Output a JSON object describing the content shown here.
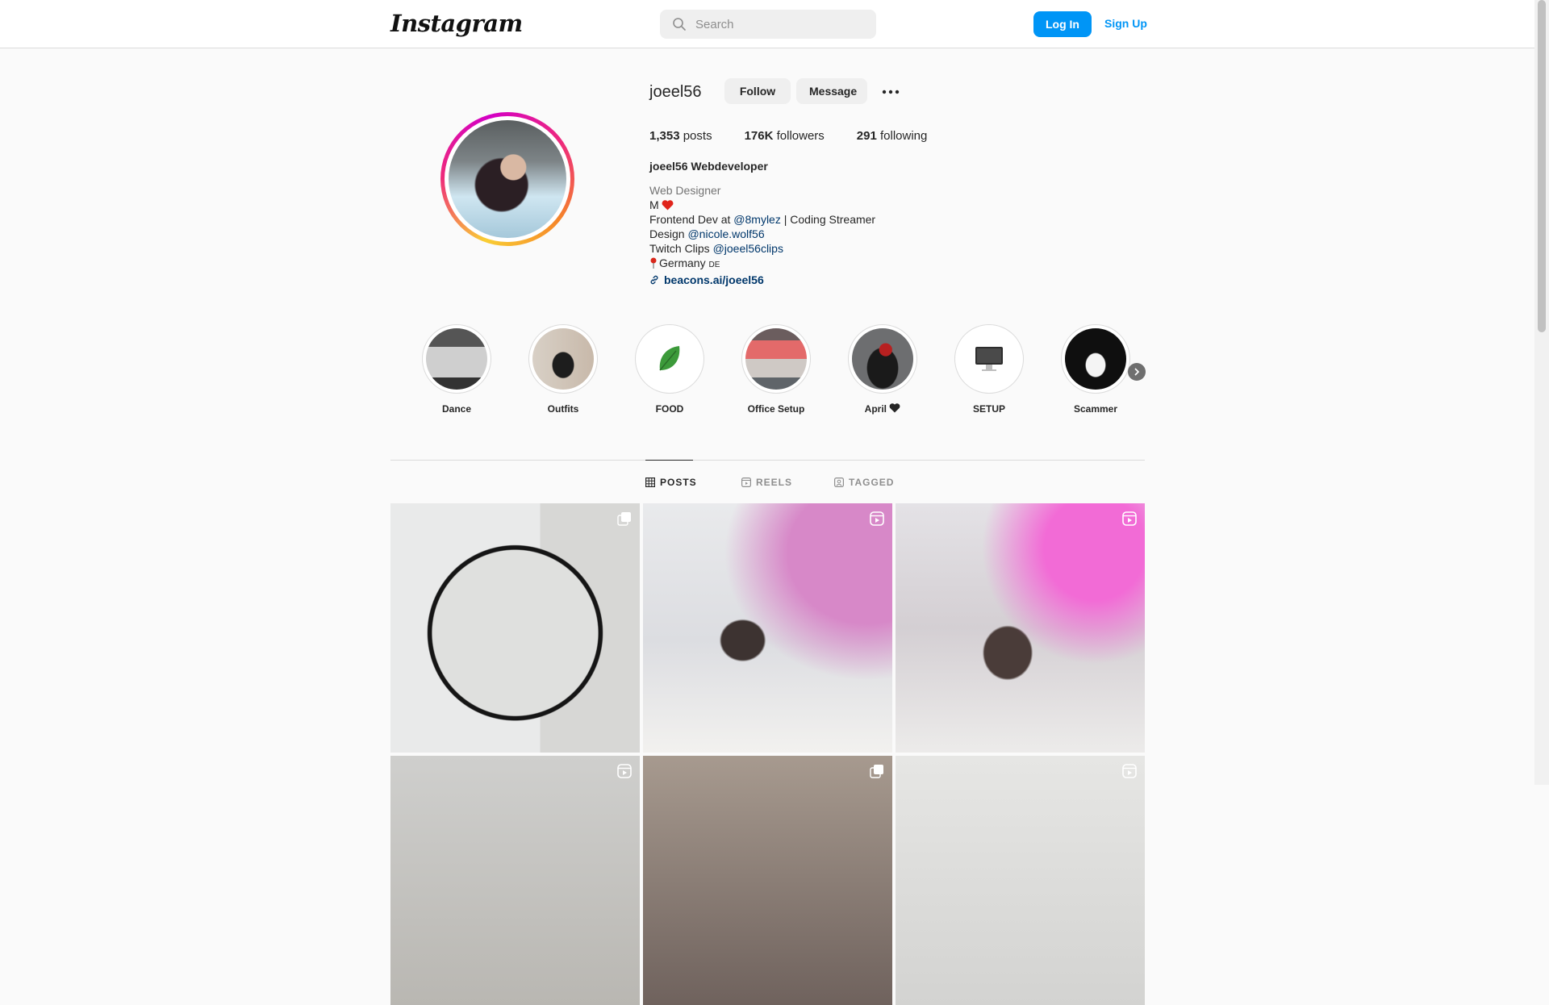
{
  "header": {
    "logo_text": "Instagram",
    "search_placeholder": "Search",
    "login_label": "Log In",
    "signup_label": "Sign Up"
  },
  "profile": {
    "username": "joeel56",
    "follow_label": "Follow",
    "message_label": "Message",
    "stats": {
      "posts_count": "1,353",
      "posts_label": "posts",
      "followers_count": "176K",
      "followers_label": "followers",
      "following_count": "291",
      "following_label": "following"
    },
    "full_name": "joeel56 Webdeveloper",
    "category": "Web Designer",
    "bio": {
      "line1": "M",
      "line2_prefix": "Frontend Dev at ",
      "line2_mention": "@8mylez",
      "line2_suffix": " | Coding Streamer",
      "line3_prefix": "Design ",
      "line3_mention": "@nicole.wolf56",
      "line4_prefix": "Twitch Clips ",
      "line4_mention": "@joeel56clips",
      "line5_text": "Germany ",
      "line5_flag": "DE",
      "link": "beacons.ai/joeel56"
    }
  },
  "highlights": [
    {
      "label": "Dance"
    },
    {
      "label": "Outfits"
    },
    {
      "label": "FOOD"
    },
    {
      "label": "Office Setup"
    },
    {
      "label": "April"
    },
    {
      "label": "SETUP"
    },
    {
      "label": "Scammer"
    }
  ],
  "tabs": {
    "posts": "POSTS",
    "reels": "REELS",
    "tagged": "TAGGED"
  },
  "posts_badges": [
    "carousel-icon",
    "reel-icon",
    "reel-icon",
    "reel-icon",
    "carousel-icon",
    "reel-icon"
  ],
  "colors": {
    "accent": "#0095f6",
    "button_gray": "#efefef",
    "text": "#262626",
    "mention": "#00376b"
  }
}
